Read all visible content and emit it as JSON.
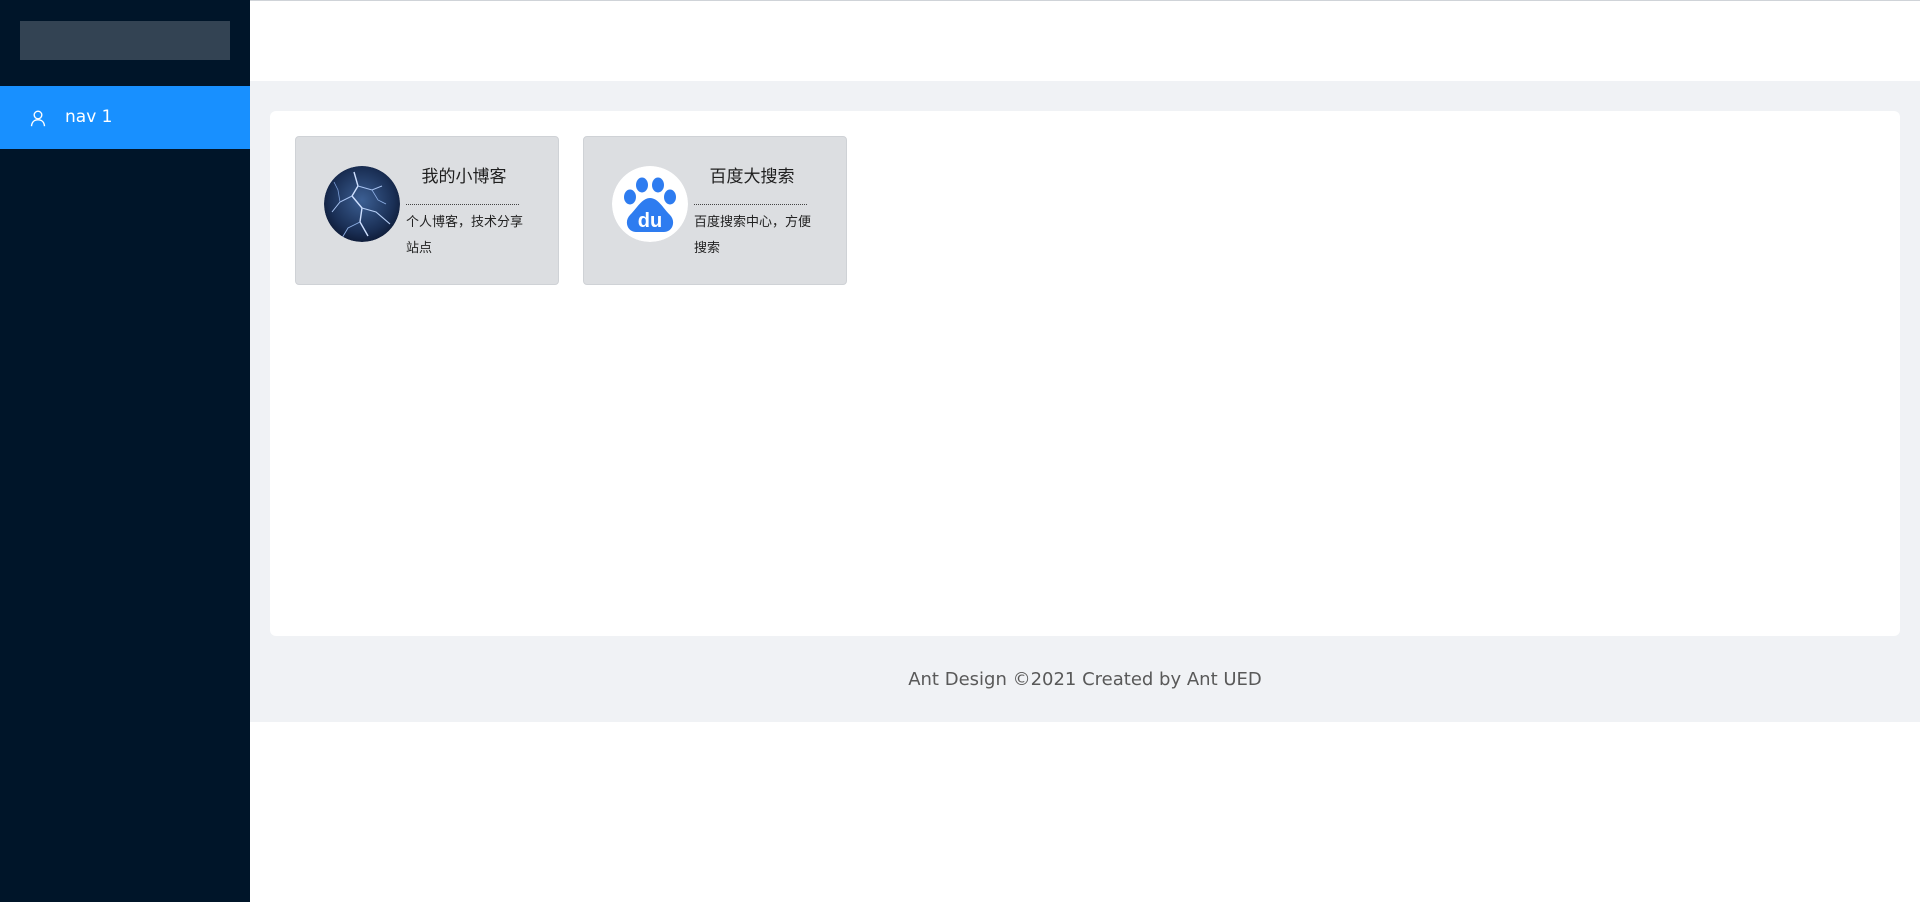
{
  "sidebar": {
    "logo": "",
    "menu": [
      {
        "label": "nav 1",
        "icon": "user-icon",
        "active": true
      }
    ]
  },
  "cards": [
    {
      "title": "我的小博客",
      "description": "个人博客，技术分享站点",
      "icon": "blog-avatar-image"
    },
    {
      "title": "百度大搜索",
      "description": "百度搜索中心，方便搜索",
      "icon": "baidu-logo-icon"
    }
  ],
  "footer": {
    "text": "Ant Design ©2021 Created by Ant UED"
  },
  "colors": {
    "sider_bg": "#001529",
    "menu_active": "#1890ff",
    "layout_bg": "#f0f2f5",
    "card_bg": "#dcdee1",
    "baidu_blue": "#2e7cf0"
  }
}
